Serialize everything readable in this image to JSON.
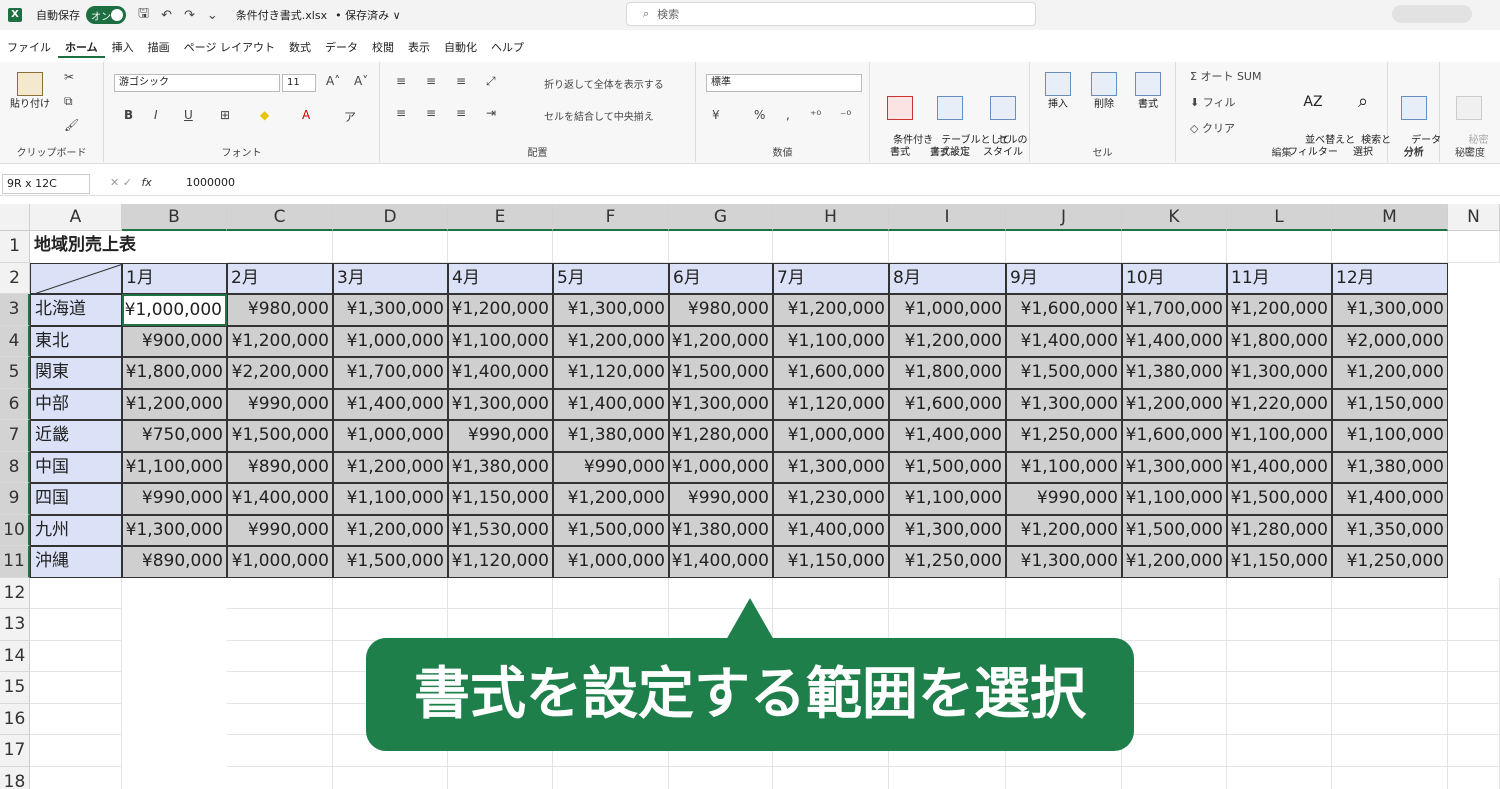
{
  "titlebar": {
    "autosave_label": "自動保存",
    "toggle_label": "オン",
    "filename": "条件付き書式.xlsx",
    "save_status": "• 保存済み ∨",
    "search_placeholder": "検索"
  },
  "menu_tabs": [
    "ファイル",
    "ホーム",
    "挿入",
    "描画",
    "ページ レイアウト",
    "数式",
    "データ",
    "校閲",
    "表示",
    "自動化",
    "ヘルプ"
  ],
  "ribbon": {
    "clipboard": {
      "paste": "貼り付け",
      "label": "クリップボード"
    },
    "font": {
      "font_name": "游ゴシック",
      "font_size": "11",
      "label": "フォント"
    },
    "alignment": {
      "wrap": "折り返して全体を表示する",
      "merge": "セルを結合して中央揃え",
      "label": "配置"
    },
    "number": {
      "format": "標準",
      "label": "数値"
    },
    "styles": {
      "conditional": "条件付き\n書式",
      "as_table": "テーブルとして\n書式設定",
      "cell_styles": "セルの\nスタイル",
      "label": "スタイル"
    },
    "cells": {
      "insert": "挿入",
      "delete": "削除",
      "format": "書式",
      "label": "セル"
    },
    "editing": {
      "autosum": "オート SUM",
      "fill": "フィル",
      "clear": "クリア",
      "sort": "並べ替えと\nフィルター",
      "find": "検索と\n選択",
      "label": "編集"
    },
    "analysis": {
      "analyze": "データ\n分析",
      "label": "分析"
    },
    "sensitivity": {
      "button": "秘密\n度",
      "label": "秘密度"
    }
  },
  "formula_bar": {
    "name_box": "9R x 12C",
    "formula": "1000000"
  },
  "sheet": {
    "columns": [
      "A",
      "B",
      "C",
      "D",
      "E",
      "F",
      "G",
      "H",
      "I",
      "J",
      "K",
      "L",
      "M",
      "N"
    ],
    "rows": [
      "1",
      "2",
      "3",
      "4",
      "5",
      "6",
      "7",
      "8",
      "9",
      "10",
      "11",
      "12",
      "13",
      "14",
      "15",
      "16",
      "17",
      "18"
    ],
    "title": "地域別売上表",
    "months": [
      "1月",
      "2月",
      "3月",
      "4月",
      "5月",
      "6月",
      "7月",
      "8月",
      "9月",
      "10月",
      "11月",
      "12月"
    ],
    "regions": [
      "北海道",
      "東北",
      "関東",
      "中部",
      "近畿",
      "中国",
      "四国",
      "九州",
      "沖縄"
    ],
    "values": [
      [
        "¥1,000,000",
        "¥980,000",
        "¥1,300,000",
        "¥1,200,000",
        "¥1,300,000",
        "¥980,000",
        "¥1,200,000",
        "¥1,000,000",
        "¥1,600,000",
        "¥1,700,000",
        "¥1,200,000",
        "¥1,300,000"
      ],
      [
        "¥900,000",
        "¥1,200,000",
        "¥1,000,000",
        "¥1,100,000",
        "¥1,200,000",
        "¥1,200,000",
        "¥1,100,000",
        "¥1,200,000",
        "¥1,400,000",
        "¥1,400,000",
        "¥1,800,000",
        "¥2,000,000"
      ],
      [
        "¥1,800,000",
        "¥2,200,000",
        "¥1,700,000",
        "¥1,400,000",
        "¥1,120,000",
        "¥1,500,000",
        "¥1,600,000",
        "¥1,800,000",
        "¥1,500,000",
        "¥1,380,000",
        "¥1,300,000",
        "¥1,200,000"
      ],
      [
        "¥1,200,000",
        "¥990,000",
        "¥1,400,000",
        "¥1,300,000",
        "¥1,400,000",
        "¥1,300,000",
        "¥1,120,000",
        "¥1,600,000",
        "¥1,300,000",
        "¥1,200,000",
        "¥1,220,000",
        "¥1,150,000"
      ],
      [
        "¥750,000",
        "¥1,500,000",
        "¥1,000,000",
        "¥990,000",
        "¥1,380,000",
        "¥1,280,000",
        "¥1,000,000",
        "¥1,400,000",
        "¥1,250,000",
        "¥1,600,000",
        "¥1,100,000",
        "¥1,100,000"
      ],
      [
        "¥1,100,000",
        "¥890,000",
        "¥1,200,000",
        "¥1,380,000",
        "¥990,000",
        "¥1,000,000",
        "¥1,300,000",
        "¥1,500,000",
        "¥1,100,000",
        "¥1,300,000",
        "¥1,400,000",
        "¥1,380,000"
      ],
      [
        "¥990,000",
        "¥1,400,000",
        "¥1,100,000",
        "¥1,150,000",
        "¥1,200,000",
        "¥990,000",
        "¥1,230,000",
        "¥1,100,000",
        "¥990,000",
        "¥1,100,000",
        "¥1,500,000",
        "¥1,400,000"
      ],
      [
        "¥1,300,000",
        "¥990,000",
        "¥1,200,000",
        "¥1,530,000",
        "¥1,500,000",
        "¥1,380,000",
        "¥1,400,000",
        "¥1,300,000",
        "¥1,200,000",
        "¥1,500,000",
        "¥1,280,000",
        "¥1,350,000"
      ],
      [
        "¥890,000",
        "¥1,000,000",
        "¥1,500,000",
        "¥1,120,000",
        "¥1,000,000",
        "¥1,400,000",
        "¥1,150,000",
        "¥1,250,000",
        "¥1,300,000",
        "¥1,200,000",
        "¥1,150,000",
        "¥1,250,000"
      ]
    ]
  },
  "callout": {
    "text": "書式を設定する範囲を選択"
  },
  "colors": {
    "accent": "#1d6f42",
    "header_fill": "#dbe2f7",
    "selection_fill": "#cfcfcf",
    "callout_bg": "#1e7f4a"
  }
}
